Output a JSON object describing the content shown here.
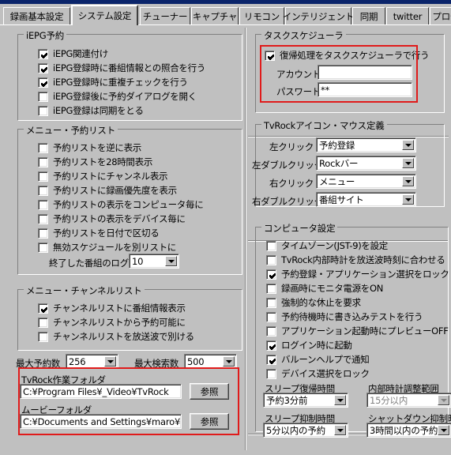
{
  "window": {
    "accent_titlebar": "#0a246a",
    "face": "#c0c0c0",
    "annotation_color": "#e01b1b"
  },
  "tabs": [
    {
      "label": "録画基本設定",
      "selected": false
    },
    {
      "label": "システム設定",
      "selected": true
    },
    {
      "label": "チューナー",
      "selected": false
    },
    {
      "label": "キャプチャ",
      "selected": false
    },
    {
      "label": "リモコン",
      "selected": false
    },
    {
      "label": "インテリジェント",
      "selected": false
    },
    {
      "label": "同期",
      "selected": false
    },
    {
      "label": "twitter",
      "selected": false
    },
    {
      "label": "プロセス",
      "selected": false
    }
  ],
  "left": {
    "iepg": {
      "title": "iEPG予約",
      "items": [
        {
          "label": "iEPG関連付け",
          "checked": true
        },
        {
          "label": "iEPG登録時に番組情報との照合を行う",
          "checked": true
        },
        {
          "label": "iEPG登録時に重複チェックを行う",
          "checked": true
        },
        {
          "label": "iEPG登録後に予約ダイアログを開く",
          "checked": false
        },
        {
          "label": "iEPG登録は同期をとる",
          "checked": false
        }
      ]
    },
    "menu_reserve": {
      "title": "メニュー・予約リスト",
      "items": [
        {
          "label": "予約リストを逆に表示",
          "checked": false
        },
        {
          "label": "予約リストを28時間表示",
          "checked": false
        },
        {
          "label": "予約リストにチャンネル表示",
          "checked": false
        },
        {
          "label": "予約リストに録画優先度を表示",
          "checked": false
        },
        {
          "label": "予約リストの表示をコンピュータ毎に",
          "checked": false
        },
        {
          "label": "予約リストの表示をデバイス毎に",
          "checked": false
        },
        {
          "label": "予約リストを日付で区切る",
          "checked": false
        },
        {
          "label": "無効スケジュールを別リストに",
          "checked": false
        }
      ],
      "log_label": "終了した番組のログ",
      "log_value": "10"
    },
    "menu_channel": {
      "title": "メニュー・チャンネルリスト",
      "items": [
        {
          "label": "チャンネルリストに番組情報表示",
          "checked": true
        },
        {
          "label": "チャンネルリストから予約可能に",
          "checked": false
        },
        {
          "label": "チャンネルリストを放送波で別ける",
          "checked": false
        }
      ]
    },
    "max_reserve_label": "最大予約数",
    "max_reserve_value": "256",
    "max_search_label": "最大検索数",
    "max_search_value": "500",
    "folders": {
      "work_label": "TvRock作業フォルダ",
      "work_value": "C:¥Program Files¥_Video¥TvRock",
      "work_button": "参照",
      "movie_label": "ムービーフォルダ",
      "movie_value": "C:¥Documents and Settings¥maro¥My D",
      "movie_button": "参照"
    }
  },
  "right": {
    "scheduler": {
      "title": "タスクスケジューラ",
      "enable_label": "復帰処理をタスクスケジューラで行う",
      "enable_checked": true,
      "account_label": "アカウント",
      "account_value": "",
      "password_label": "パスワード",
      "password_value": "**"
    },
    "mouse": {
      "title": "TvRockアイコン・マウス定義",
      "rows": [
        {
          "label": "左クリック",
          "value": "予約登録"
        },
        {
          "label": "左ダブルクリック",
          "value": "Rockバー"
        },
        {
          "label": "右クリック",
          "value": "メニュー"
        },
        {
          "label": "右ダブルクリック",
          "value": "番組サイト"
        }
      ]
    },
    "computer": {
      "title": "コンピュータ設定",
      "items": [
        {
          "label": "タイムゾーン(JST-9)を設定",
          "checked": false
        },
        {
          "label": "TvRock内部時計を放送波時刻に合わせる",
          "checked": false
        },
        {
          "label": "予約登録・アプリケーション選択をロック",
          "checked": true
        },
        {
          "label": "録画時にモニタ電源をON",
          "checked": false
        },
        {
          "label": "強制的な休止を要求",
          "checked": false
        },
        {
          "label": "予約待機時に書き込みテストを行う",
          "checked": false
        },
        {
          "label": "アプリケーション起動時にプレビューOFF",
          "checked": false
        },
        {
          "label": "ログイン時に起動",
          "checked": true
        },
        {
          "label": "バルーンヘルプで通知",
          "checked": true
        },
        {
          "label": "デバイス選択をロック",
          "checked": false
        }
      ],
      "sleep_wake_label": "スリープ復帰時間",
      "sleep_wake_value": "予約3分前",
      "clock_adjust_label": "内部時計調整範囲",
      "clock_adjust_value": "15分以内",
      "clock_adjust_disabled": true,
      "sleep_inhibit_label": "スリープ抑制時間",
      "sleep_inhibit_value": "5分以内の予約",
      "shutdown_inhibit_label": "シャットダウン抑制時間",
      "shutdown_inhibit_value": "3時間以内の予約"
    }
  }
}
